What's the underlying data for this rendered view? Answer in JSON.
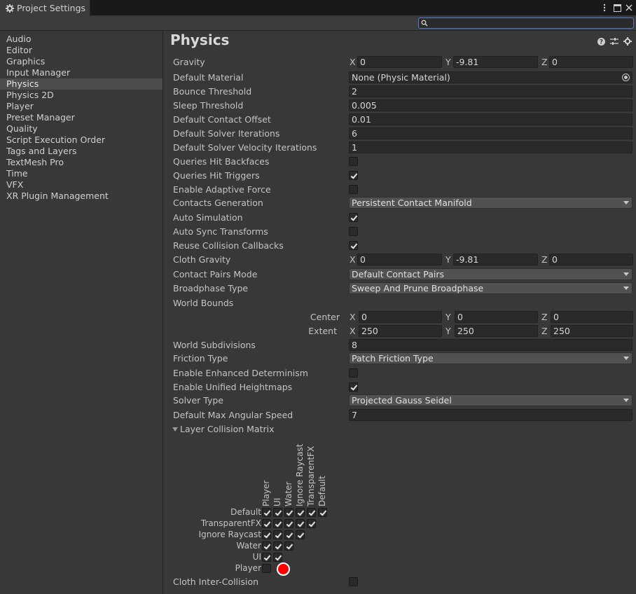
{
  "window": {
    "tab_title": "Project Settings",
    "colors": {
      "accent": "#4b7ad1",
      "selection": "#4d4d4d",
      "cursor": "#ff0000"
    }
  },
  "search": {
    "placeholder": "",
    "value": ""
  },
  "sidebar": {
    "items": [
      {
        "label": "Audio"
      },
      {
        "label": "Editor"
      },
      {
        "label": "Graphics"
      },
      {
        "label": "Input Manager"
      },
      {
        "label": "Physics",
        "selected": true
      },
      {
        "label": "Physics 2D"
      },
      {
        "label": "Player"
      },
      {
        "label": "Preset Manager"
      },
      {
        "label": "Quality"
      },
      {
        "label": "Script Execution Order"
      },
      {
        "label": "Tags and Layers"
      },
      {
        "label": "TextMesh Pro"
      },
      {
        "label": "Time"
      },
      {
        "label": "VFX"
      },
      {
        "label": "XR Plugin Management"
      }
    ]
  },
  "physics": {
    "title": "Physics",
    "axis": {
      "x": "X",
      "y": "Y",
      "z": "Z"
    },
    "gravity": {
      "label": "Gravity",
      "x": "0",
      "y": "-9.81",
      "z": "0"
    },
    "default_material": {
      "label": "Default Material",
      "value": "None (Physic Material)"
    },
    "bounce_threshold": {
      "label": "Bounce Threshold",
      "value": "2"
    },
    "sleep_threshold": {
      "label": "Sleep Threshold",
      "value": "0.005"
    },
    "default_contact_offset": {
      "label": "Default Contact Offset",
      "value": "0.01"
    },
    "default_solver_iterations": {
      "label": "Default Solver Iterations",
      "value": "6"
    },
    "default_solver_velocity_iterations": {
      "label": "Default Solver Velocity Iterations",
      "value": "1"
    },
    "queries_hit_backfaces": {
      "label": "Queries Hit Backfaces",
      "checked": false
    },
    "queries_hit_triggers": {
      "label": "Queries Hit Triggers",
      "checked": true
    },
    "enable_adaptive_force": {
      "label": "Enable Adaptive Force",
      "checked": false
    },
    "contacts_generation": {
      "label": "Contacts Generation",
      "value": "Persistent Contact Manifold"
    },
    "auto_simulation": {
      "label": "Auto Simulation",
      "checked": true
    },
    "auto_sync_transforms": {
      "label": "Auto Sync Transforms",
      "checked": false
    },
    "reuse_collision_callbacks": {
      "label": "Reuse Collision Callbacks",
      "checked": true
    },
    "cloth_gravity": {
      "label": "Cloth Gravity",
      "x": "0",
      "y": "-9.81",
      "z": "0"
    },
    "contact_pairs_mode": {
      "label": "Contact Pairs Mode",
      "value": "Default Contact Pairs"
    },
    "broadphase_type": {
      "label": "Broadphase Type",
      "value": "Sweep And Prune Broadphase"
    },
    "world_bounds": {
      "label": "World Bounds",
      "center": {
        "label": "Center",
        "x": "0",
        "y": "0",
        "z": "0"
      },
      "extent": {
        "label": "Extent",
        "x": "250",
        "y": "250",
        "z": "250"
      }
    },
    "world_subdivisions": {
      "label": "World Subdivisions",
      "value": "8"
    },
    "friction_type": {
      "label": "Friction Type",
      "value": "Patch Friction Type"
    },
    "enable_enhanced_determinism": {
      "label": "Enable Enhanced Determinism",
      "checked": false
    },
    "enable_unified_heightmaps": {
      "label": "Enable Unified Heightmaps",
      "checked": true
    },
    "solver_type": {
      "label": "Solver Type",
      "value": "Projected Gauss Seidel"
    },
    "default_max_angular_speed": {
      "label": "Default Max Angular Speed",
      "value": "7"
    },
    "layer_collision_matrix": {
      "label": "Layer Collision Matrix",
      "columns": [
        "Player",
        "UI",
        "Water",
        "Ignore Raycast",
        "TransparentFX",
        "Default"
      ],
      "rows": [
        {
          "label": "Default",
          "cells": [
            true,
            true,
            true,
            true,
            true,
            true
          ]
        },
        {
          "label": "TransparentFX",
          "cells": [
            true,
            true,
            true,
            true,
            true
          ]
        },
        {
          "label": "Ignore Raycast",
          "cells": [
            true,
            true,
            true,
            true
          ]
        },
        {
          "label": "Water",
          "cells": [
            true,
            true,
            true
          ]
        },
        {
          "label": "UI",
          "cells": [
            true,
            true
          ]
        },
        {
          "label": "Player",
          "cells": [
            false
          ]
        }
      ]
    },
    "cloth_inter_collision": {
      "label": "Cloth Inter-Collision",
      "checked": false
    }
  }
}
